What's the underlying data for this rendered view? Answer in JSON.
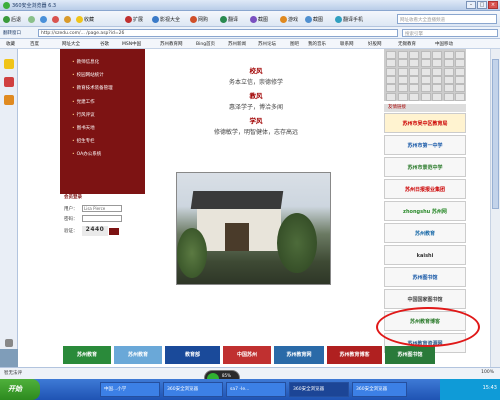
{
  "window": {
    "title": "360安全浏览器 6.3"
  },
  "toolbar": {
    "back": "后退",
    "refresh": "",
    "favorites": "收藏",
    "items": [
      "扩展",
      "影视大全",
      "网购",
      "翻译",
      "截图",
      "游戏",
      "截图",
      "翻译手机"
    ],
    "search_placeholder": "网址收看大全直播频道"
  },
  "address": {
    "label": "翻转窗口",
    "url": "http://szedu.com/...  /page.asp?id=26",
    "search_placeholder": "搜索引擎"
  },
  "bookmarks": [
    "收藏",
    "百度",
    "网址大全",
    "谷歌",
    "MSN中国",
    "苏州教育网",
    "Bing首页",
    "苏州新闻",
    "苏州论坛",
    "图吧",
    "我的音乐",
    "联系网",
    "好股网",
    "无锡教育",
    "中国移动"
  ],
  "site": {
    "menu": [
      "教师信息化",
      "校园网站统计",
      "教育技术装备管理",
      "党建工作",
      "行风评议",
      "图书天地",
      "招生专栏",
      "OA办公系统"
    ],
    "login": {
      "title": "会员登录",
      "user_label": "用户：",
      "pass_label": "密码：",
      "code_label": "验证：",
      "user_value": "Lisa Pierce",
      "captcha": "2440"
    },
    "motto": {
      "school_title": "校风",
      "school_text": "务本立信，崇德修学",
      "teach_title": "教风",
      "teach_text": "惠泽学子，博洽多闻",
      "study_title": "学风",
      "study_text": "修德敏学，明智健体，志存高远"
    },
    "friend_links_title": "友情链接",
    "friend_links": [
      "苏州市吴中区教育局",
      "苏州市第一中学",
      "苏州市景范中学",
      "苏州日报报业集团",
      "zhongshu 苏州网",
      "苏州教育",
      "kaishi",
      "苏州图书馆",
      "中国国家图书馆",
      "苏州教育博客",
      "苏州教育资源网"
    ],
    "bottom_banners": [
      "苏州教育",
      "苏州教育",
      "教育部",
      "中国苏州",
      "苏州教育网",
      "苏州教育博客",
      "苏州图书馆"
    ]
  },
  "status": {
    "left": "智无法评",
    "zoom": "100%"
  },
  "taskbar": {
    "start": "开始",
    "tasks": [
      "中国...小学",
      "360安全浏览器",
      "sa7 -Ie...",
      "360安全浏览器",
      "360安全浏览器"
    ],
    "clock": "15:43",
    "widget_value": "85%"
  }
}
